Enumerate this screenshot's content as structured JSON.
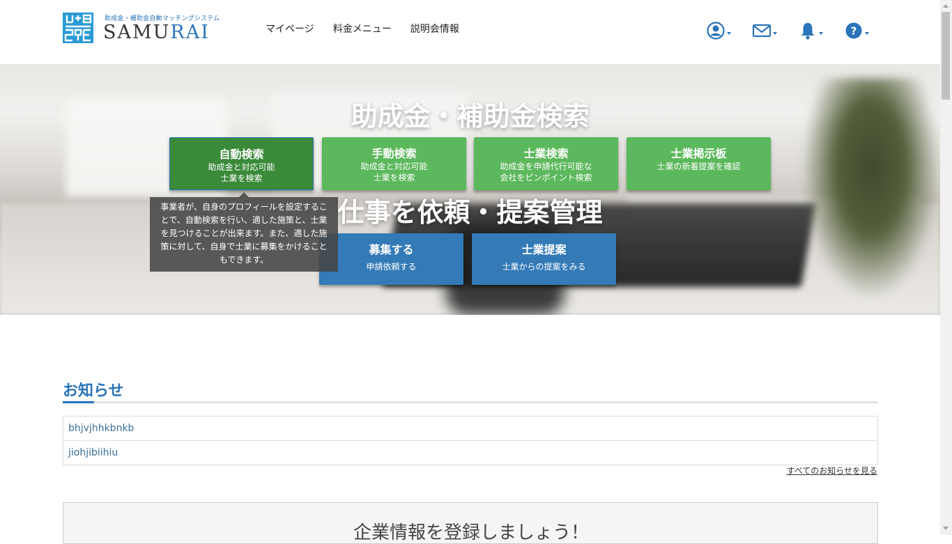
{
  "header": {
    "logo_tagline": "助成金・補助金自動マッチングシステム",
    "logo_text_a": "SAMU",
    "logo_text_b": "RAI",
    "nav": [
      {
        "label": "マイページ"
      },
      {
        "label": "料金メニュー"
      },
      {
        "label": "説明会情報"
      }
    ],
    "icons": [
      "user-icon",
      "mail-icon",
      "bell-icon",
      "help-icon"
    ],
    "accent_color": "#2a74b9"
  },
  "hero": {
    "search_title": "助成金・補助金検索",
    "search_tiles": [
      {
        "title": "自動検索",
        "sub": "助成金と対応可能\n士業を検索",
        "active": true
      },
      {
        "title": "手動検索",
        "sub": "助成金と対応可能\n士業を検索"
      },
      {
        "title": "士業検索",
        "sub": "助成金を申請代行可能な\n会社をピンポイント検索"
      },
      {
        "title": "士業掲示板",
        "sub": "士業の新着提案を確認"
      }
    ],
    "request_title": "仕事を依頼・提案管理",
    "request_tiles": [
      {
        "title": "募集する",
        "sub": "申請依頼する"
      },
      {
        "title": "士業提案",
        "sub": "士業からの提案をみる"
      }
    ],
    "tooltip": "事業者が、自身のプロフィールを設定することで、自動検索を行い、適した施策と、士業を見つけることが出来ます。また、適した施策に対して、自身で士業に募集をかけることもできます。",
    "green_color": "#5cb85c",
    "blue_color": "#337ab7"
  },
  "news": {
    "heading": "お知らせ",
    "items": [
      {
        "label": "bhjvjhhkbnkb"
      },
      {
        "label": "jiohjibiihiu"
      }
    ],
    "all_link": "すべてのお知らせを見る"
  },
  "cta": {
    "title": "企業情報を登録しましょう！"
  }
}
